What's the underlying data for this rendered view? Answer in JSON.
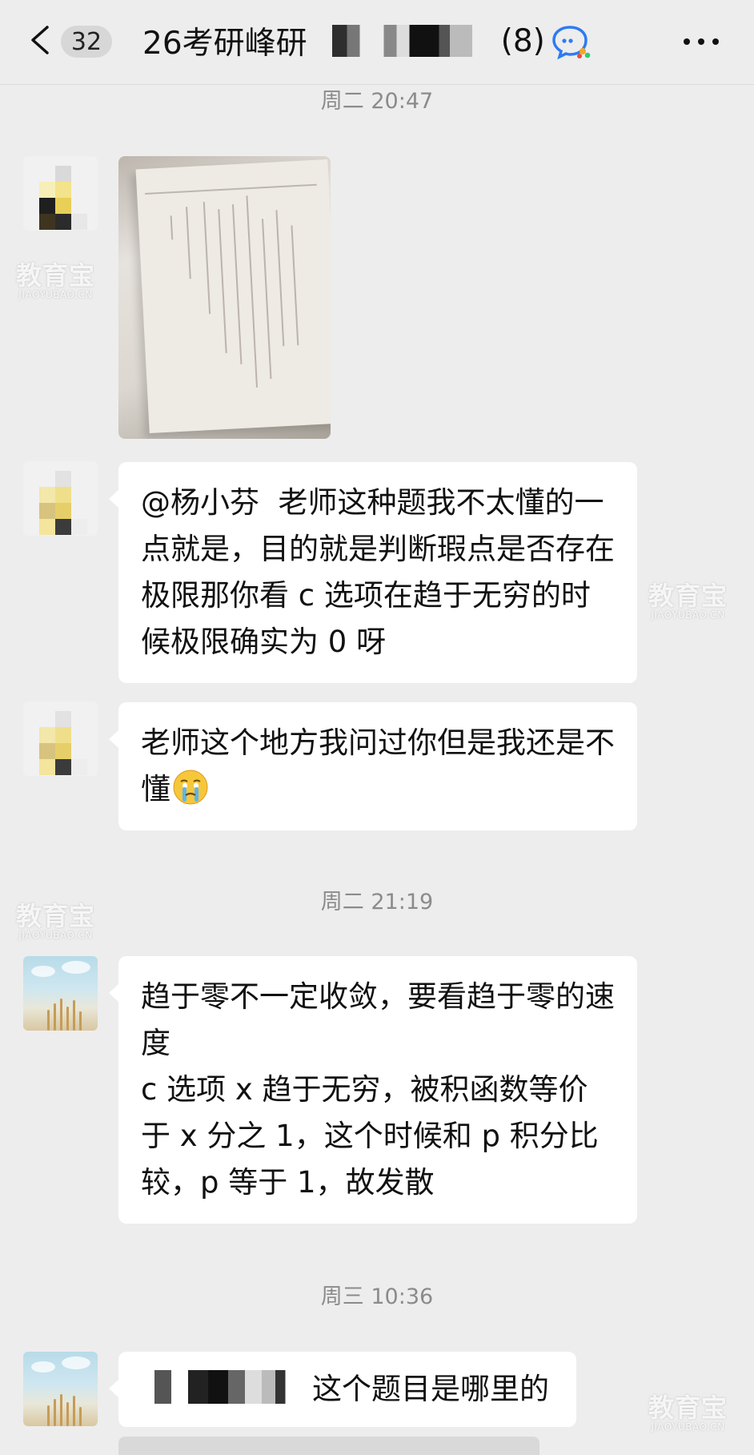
{
  "header": {
    "unread_count": "32",
    "title": "26考研峰研",
    "member_count": "(8)"
  },
  "timestamps": {
    "t1": "周二 20:47",
    "t2": "周二 21:19",
    "t3": "周三 10:36"
  },
  "messages": {
    "m2": "@杨小芬  老师这种题我不太懂的一点就是，目的就是判断瑕点是否存在极限那你看 c 选项在趋于无穷的时候极限确实为 0 呀",
    "m3": "老师这个地方我问过你但是我还是不懂",
    "m4": "趋于零不一定收敛，要看趋于零的速度\nc 选项 x 趋于无穷，被积函数等价于 x 分之 1，这个时候和 p 积分比较，p 等于 1，故发散",
    "m5": "这个题目是哪里的"
  },
  "watermark": {
    "main": "教育宝",
    "sub": "JIAOYUBAO.CN"
  },
  "icons": {
    "back": "chevron-left-icon",
    "group": "group-chat-icon",
    "more": "more-dots-icon",
    "emoji": "crying-face-emoji"
  }
}
